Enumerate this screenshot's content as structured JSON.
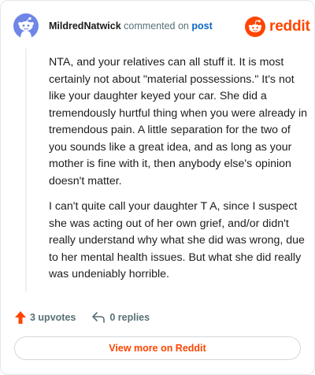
{
  "header": {
    "username": "MildredNatwick",
    "commented_on": "commented on",
    "post_link": "post",
    "avatar_icon": "snoo-avatar-icon",
    "logo_icon": "reddit-logo-icon",
    "logo_text": "reddit"
  },
  "comment": {
    "paragraphs": [
      "NTA, and your relatives can all stuff it. It is most certainly not about \"material possessions.\" It's not like your daughter keyed your car. She did a tremendously hurtful thing when you were already in tremendous pain. A little separation for the two of you sounds like a great idea, and as long as your mother is fine with it, then anybody else's opinion doesn't matter.",
      "I can't quite call your daughter T A, since I suspect she was acting out of her own grief, and/or didn't really understand why what she did was wrong, due to her mental health issues. But what she did really was undeniably horrible."
    ]
  },
  "actions": {
    "upvotes": "3 upvotes",
    "upvote_icon": "upvote-arrow-icon",
    "replies": "0 replies",
    "reply_icon": "reply-arrow-icon"
  },
  "footer": {
    "view_more": "View more on Reddit"
  },
  "colors": {
    "brand": "#ff4500",
    "link": "#0a66c2",
    "muted": "#576f76",
    "avatar_bg": "#6f86e6"
  }
}
